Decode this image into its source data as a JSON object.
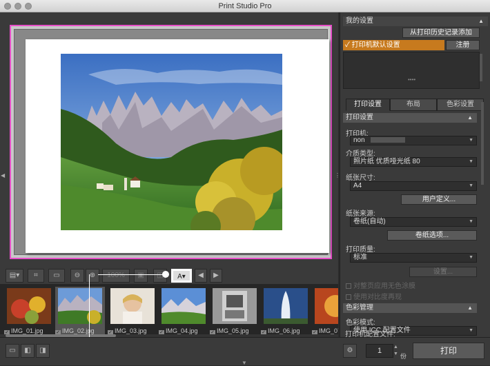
{
  "window": {
    "title": "Print Studio Pro"
  },
  "my_settings": {
    "header": "我的设置",
    "add_from_history": "从打印历史记录添加",
    "default_item": "✓ 打印机默认设置",
    "register": "注册"
  },
  "tabs": [
    "打印设置",
    "布局",
    "色彩设置"
  ],
  "print_settings": {
    "header": "打印设置",
    "printer_label": "打印机:",
    "printer_value": "non",
    "media_label": "介质类型:",
    "media_value": "照片纸 优质哑光纸 80",
    "paper_size_label": "纸张尺寸:",
    "paper_size_value": "A4",
    "user_defined": "用户定义...",
    "paper_source_label": "纸张来源:",
    "paper_source_value": "卷纸(自动)",
    "roll_options": "卷纸选项...",
    "quality_label": "打印质量:",
    "quality_value": "标准",
    "settings_btn": "设置...",
    "borderless_label": "对整页应用无色涂膜",
    "contrast_label": "使用对比度再现"
  },
  "color_management": {
    "header": "色彩管理",
    "mode_label": "色彩模式:",
    "mode_value": "使用 ICC 配置文件",
    "profile_label": "打印机配置文件:"
  },
  "toolbar": {
    "zoom_value": "100%"
  },
  "thumbnails": [
    {
      "name": "IMG_01.jpg",
      "selected": false
    },
    {
      "name": "IMG_02.jpg",
      "selected": true
    },
    {
      "name": "IMG_03.jpg",
      "selected": false
    },
    {
      "name": "IMG_04.jpg",
      "selected": false
    },
    {
      "name": "IMG_05.jpg",
      "selected": false
    },
    {
      "name": "IMG_06.jpg",
      "selected": false
    },
    {
      "name": "IMG_07.jpg",
      "selected": false
    }
  ],
  "bottom": {
    "copies": "1",
    "copies_unit": "份",
    "print": "打印"
  },
  "colors": {
    "highlight": "#e64ec8",
    "accent": "#c77a1e"
  }
}
